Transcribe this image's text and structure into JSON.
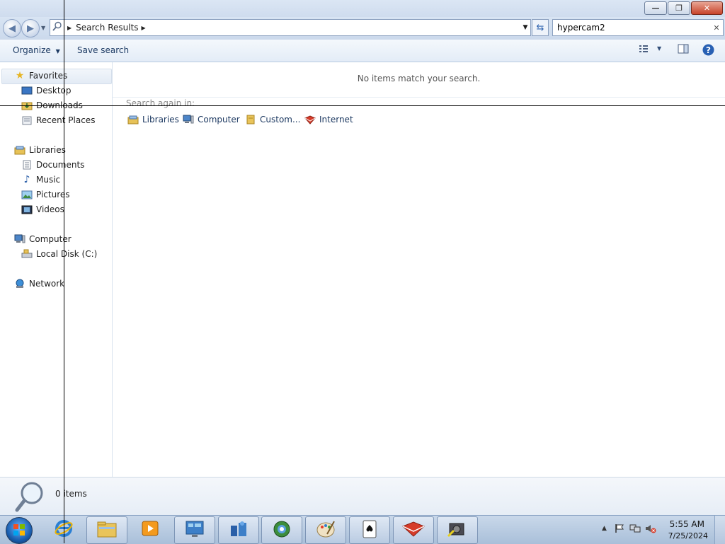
{
  "window": {
    "minimize_label": "—",
    "restore_label": "❐",
    "close_label": "✕"
  },
  "address": {
    "path": "Search Results",
    "search_value": "hypercam2"
  },
  "toolbar": {
    "organize_label": "Organize",
    "save_search_label": "Save search"
  },
  "nav": {
    "favorites_label": "Favorites",
    "favorites_items": [
      "Desktop",
      "Downloads",
      "Recent Places"
    ],
    "libraries_label": "Libraries",
    "libraries_items": [
      "Documents",
      "Music",
      "Pictures",
      "Videos"
    ],
    "computer_label": "Computer",
    "computer_items": [
      "Local Disk (C:)"
    ],
    "network_label": "Network"
  },
  "content": {
    "empty_message": "No items match your search.",
    "search_again_label": "Search again in:",
    "search_again_items": [
      "Libraries",
      "Computer",
      "Custom...",
      "Internet"
    ]
  },
  "details": {
    "count_text": "0 items"
  },
  "taskbar": {
    "time": "5:55 AM",
    "date": "7/25/2024",
    "apps": [
      "internet-explorer",
      "windows-explorer",
      "media-player",
      "control-panel",
      "network-app",
      "browser",
      "paint",
      "solitaire",
      "red-app",
      "hypercam"
    ]
  },
  "colors": {
    "accent": "#2f64b0",
    "close_button": "#c7432a"
  }
}
